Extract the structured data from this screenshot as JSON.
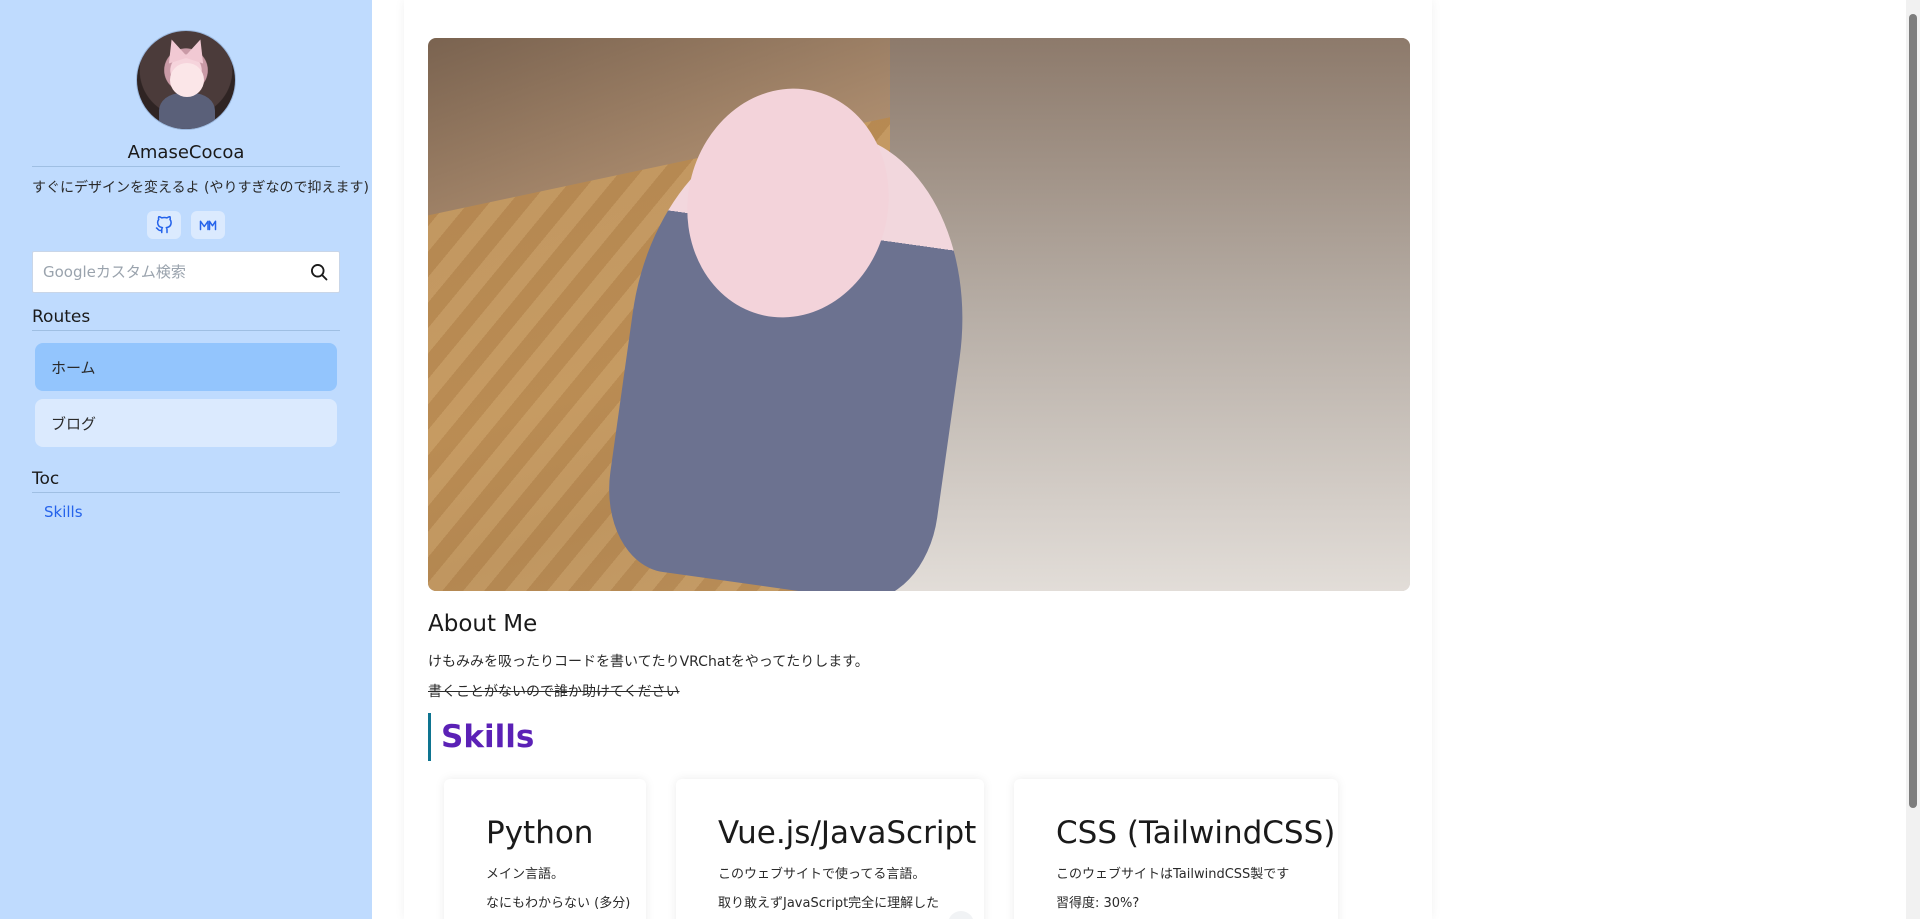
{
  "profile": {
    "name": "AmaseCocoa",
    "bio": "すぐにデザインを変えるよ (やりすぎなので抑えます)",
    "social": [
      {
        "icon": "github-icon"
      },
      {
        "icon": "misskey-icon"
      }
    ]
  },
  "search": {
    "placeholder": "Googleカスタム検索",
    "value": ""
  },
  "routes": {
    "heading": "Routes",
    "items": [
      {
        "label": "ホーム",
        "active": true
      },
      {
        "label": "ブログ",
        "active": false
      }
    ]
  },
  "toc": {
    "heading": "Toc",
    "items": [
      {
        "label": "Skills"
      }
    ]
  },
  "about": {
    "title": "About Me",
    "line1": "けもみみを吸ったりコードを書いてたりVRChatをやってたりします。",
    "line2": "書くことがないので誰か助けてください"
  },
  "skills": {
    "heading": "Skills",
    "items": [
      {
        "title": "Python",
        "desc": "メイン言語。",
        "desc2": "なにもわからない (多分)"
      },
      {
        "title": "Vue.js/JavaScript",
        "desc": "このウェブサイトで使ってる言語。",
        "desc2": "取り敢えずJavaScript完全に理解した"
      },
      {
        "title": "CSS (TailwindCSS)",
        "desc": "このウェブサイトはTailwindCSS製です",
        "desc2": "習得度: 30%?"
      }
    ]
  },
  "colors": {
    "sidebar_bg": "#bfdbfe",
    "active_route": "#93c5fd",
    "skills_heading": "#5b21b6",
    "link": "#2563eb"
  }
}
